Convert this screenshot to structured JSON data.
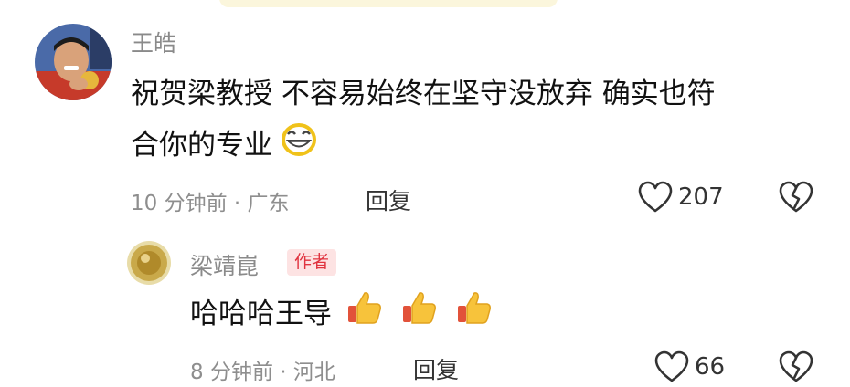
{
  "comment": {
    "author": "王皓",
    "text_line1": "祝贺梁教授 不容易始终在坚守没放弃 确实也符",
    "text_line2": "合你的专业",
    "emoji_icon": "grinning-face-icon",
    "time": "10 分钟前 · 广东",
    "reply_label": "回复",
    "like_count": "207"
  },
  "reply": {
    "author": "梁靖崑",
    "badge": "作者",
    "text": "哈哈哈王导",
    "emoji_icons": [
      "thumbs-up-icon",
      "thumbs-up-icon",
      "thumbs-up-icon"
    ],
    "time": "8 分钟前 · 河北",
    "reply_label": "回复",
    "like_count": "66"
  },
  "colors": {
    "badge_bg": "#fde3e3",
    "badge_text": "#e0333f",
    "meta_text": "#8e8e8e"
  }
}
